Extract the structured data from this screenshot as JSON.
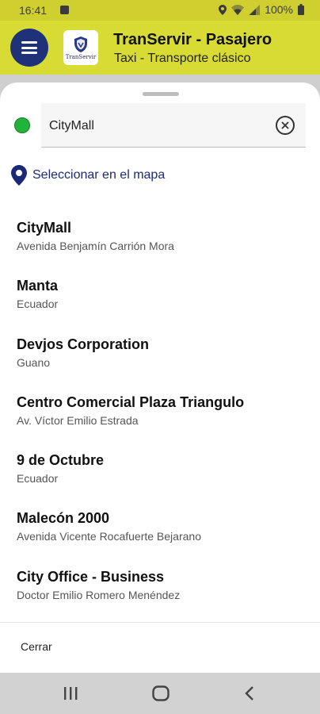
{
  "status_bar": {
    "time": "16:41",
    "battery": "100%"
  },
  "app_bar": {
    "title": "TranServir - Pasajero",
    "subtitle": "Taxi - Transporte clásico",
    "logo_text": "TranServir"
  },
  "search": {
    "value": "CityMall"
  },
  "map_select": {
    "label": "Seleccionar en el mapa"
  },
  "results": [
    {
      "title": "CityMall",
      "subtitle": "Avenida Benjamín Carrión Mora"
    },
    {
      "title": "Manta",
      "subtitle": "Ecuador"
    },
    {
      "title": "Devjos Corporation",
      "subtitle": "Guano"
    },
    {
      "title": "Centro Comercial Plaza Triangulo",
      "subtitle": "Av. Víctor Emilio Estrada"
    },
    {
      "title": "9 de Octubre",
      "subtitle": "Ecuador"
    },
    {
      "title": "Malecón 2000",
      "subtitle": "Avenida Vicente Rocafuerte Bejarano"
    },
    {
      "title": "City Office - Business",
      "subtitle": "Doctor Emilio Romero Menéndez"
    }
  ],
  "close_label": "Cerrar",
  "colors": {
    "app_bar": "#d8db33",
    "menu_button": "#1f3279",
    "origin_dot": "#22b43a",
    "link": "#1b2a78"
  }
}
